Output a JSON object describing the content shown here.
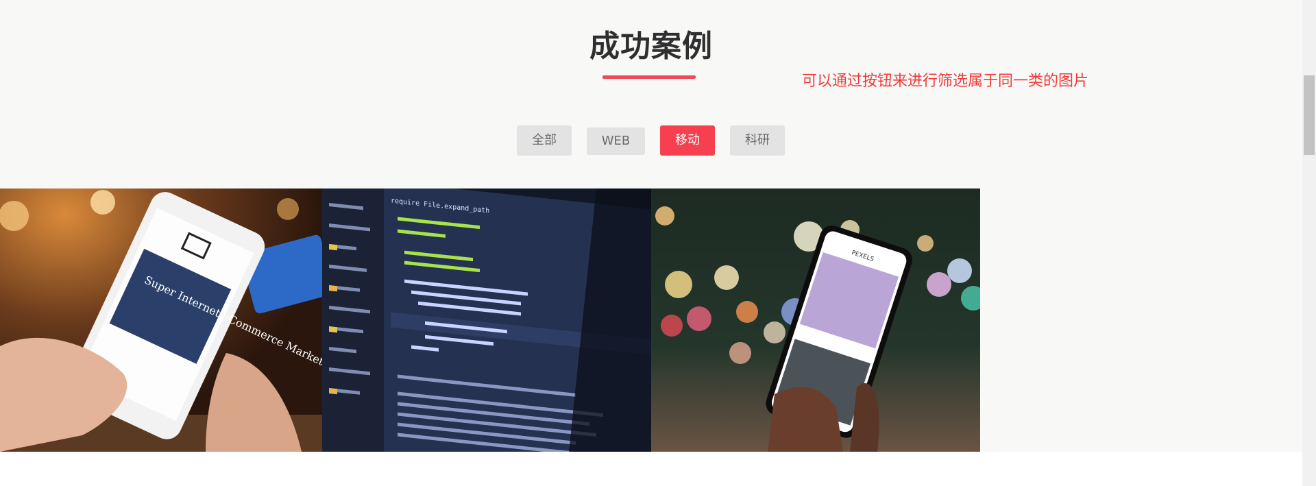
{
  "section": {
    "title": "成功案例",
    "hint": "可以通过按钮来进行筛选属于同一类的图片",
    "accent_color": "#f6404f"
  },
  "filters": {
    "all": "全部",
    "web": "WEB",
    "mobile": "移动",
    "research": "科研",
    "active": "移动"
  },
  "gallery": {
    "items": [
      {
        "icon": "phone-shopping-image",
        "screen_text": "Super Internet eCommerce Market"
      },
      {
        "icon": "code-editor-image",
        "screen_text": "require File.expand_path"
      },
      {
        "icon": "phone-photo-bokeh-image",
        "screen_text": "PEXELS"
      }
    ]
  }
}
